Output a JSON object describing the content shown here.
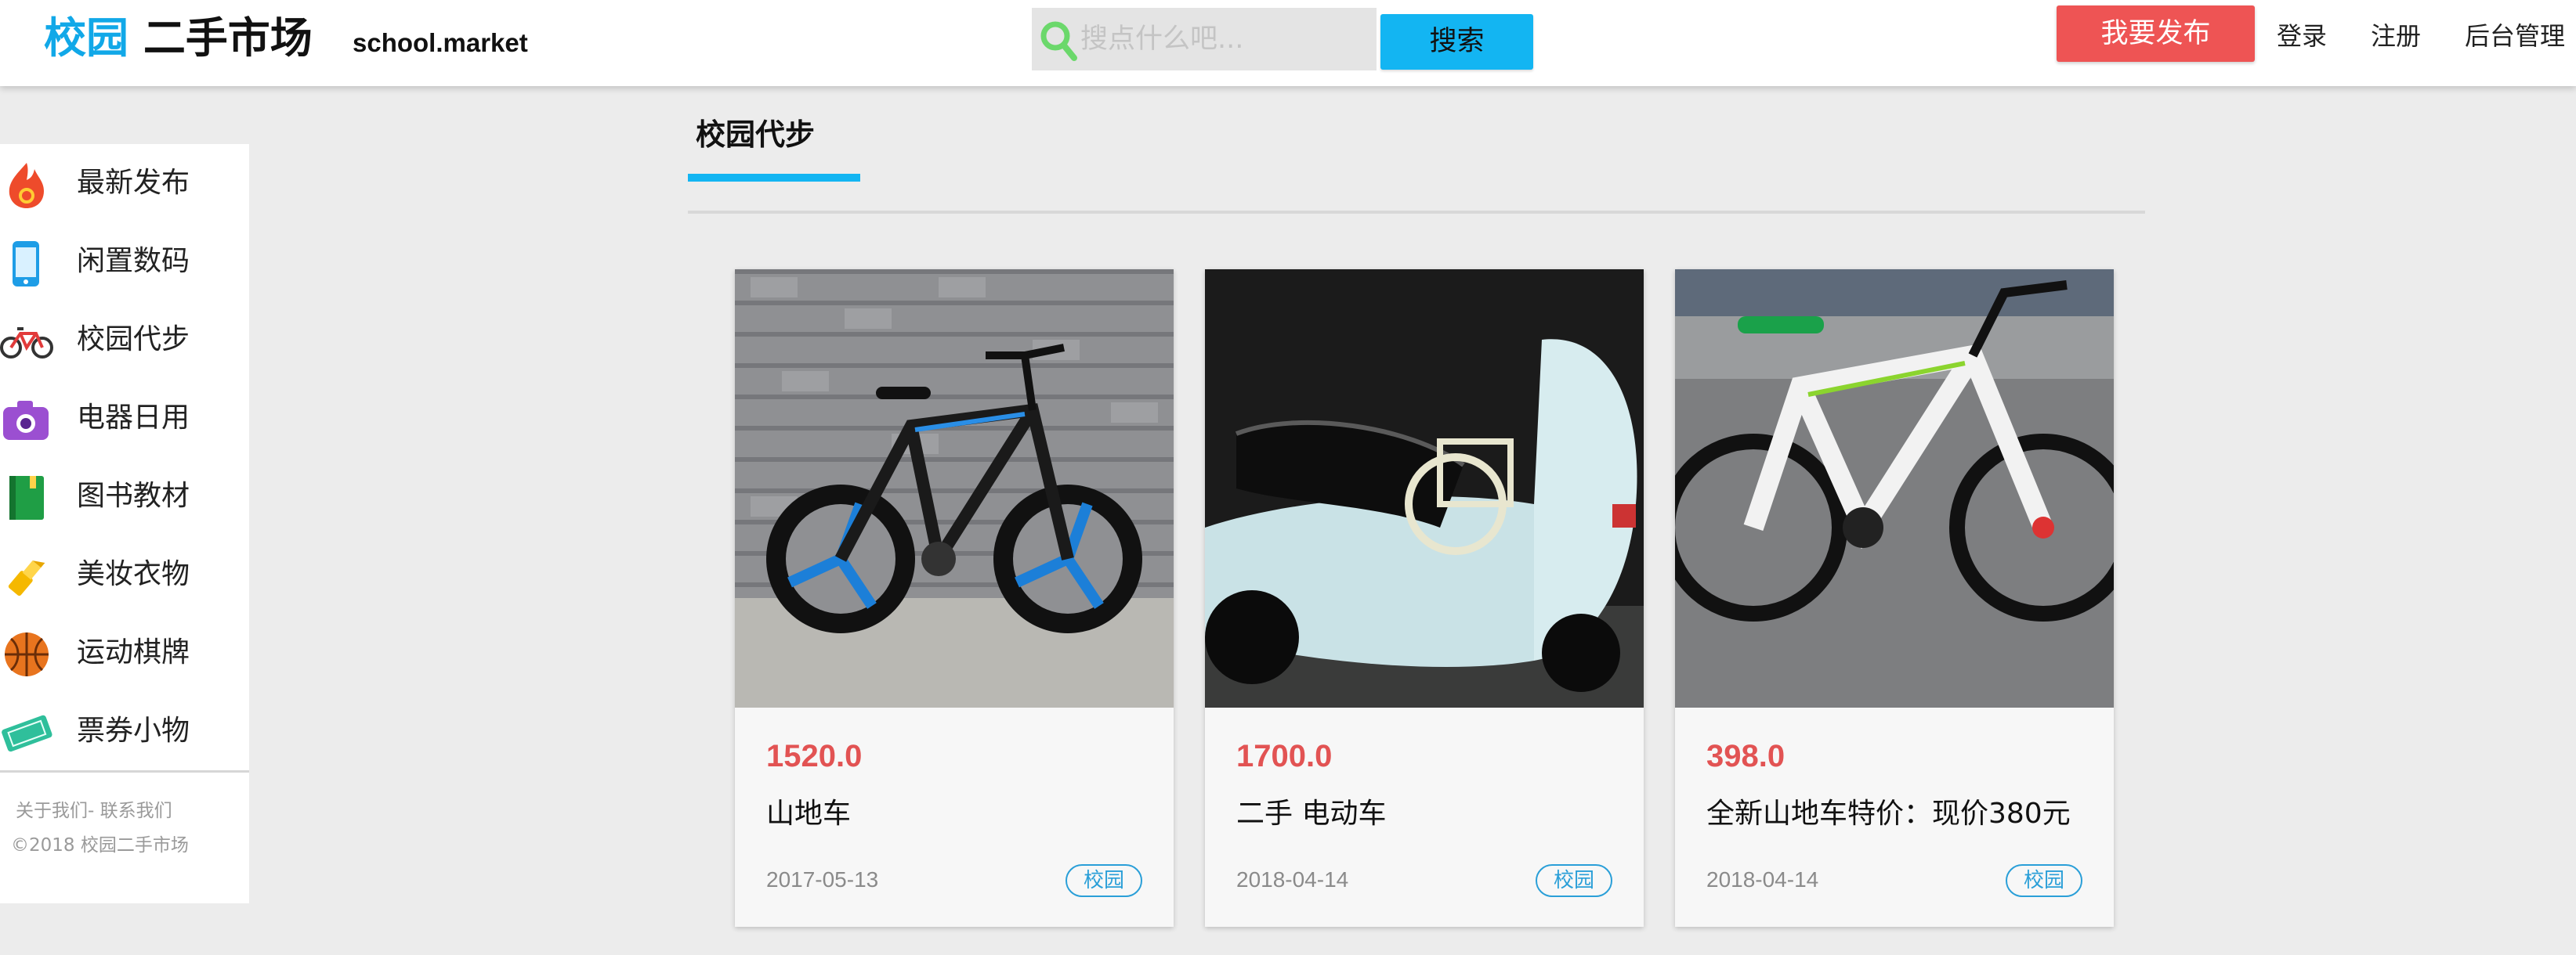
{
  "header": {
    "logo_brand": "校园",
    "logo_rest": "二手市场",
    "domain": "school.market",
    "search_placeholder": "搜点什么吧...",
    "search_button": "搜索",
    "publish_button": "我要发布",
    "nav": [
      "登录",
      "注册",
      "后台管理"
    ]
  },
  "sidebar": {
    "items": [
      {
        "label": "最新发布",
        "icon": "flame-icon"
      },
      {
        "label": "闲置数码",
        "icon": "phone-icon"
      },
      {
        "label": "校园代步",
        "icon": "bicycle-icon"
      },
      {
        "label": "电器日用",
        "icon": "camera-icon"
      },
      {
        "label": "图书教材",
        "icon": "book-icon"
      },
      {
        "label": "美妆衣物",
        "icon": "lipstick-icon"
      },
      {
        "label": "运动棋牌",
        "icon": "basketball-icon"
      },
      {
        "label": "票券小物",
        "icon": "ticket-icon"
      }
    ],
    "footer_links": "关于我们- 联系我们",
    "footer_copy": "©2018 校园二手市场"
  },
  "main": {
    "section_title": "校园代步",
    "cards": [
      {
        "price": "1520.0",
        "title": "山地车",
        "date": "2017-05-13",
        "tag": "校园",
        "image": "mountain-bike-photo"
      },
      {
        "price": "1700.0",
        "title": "二手 电动车",
        "date": "2018-04-14",
        "tag": "校园",
        "image": "electric-scooter-photo"
      },
      {
        "price": "398.0",
        "title": "全新山地车特价：现价380元",
        "date": "2018-04-14",
        "tag": "校园",
        "image": "white-mountain-bike-photo"
      }
    ]
  },
  "colors": {
    "accent": "#13b5f2",
    "publish": "#ee5454",
    "price": "#e25353",
    "tag": "#2a9fd8"
  }
}
